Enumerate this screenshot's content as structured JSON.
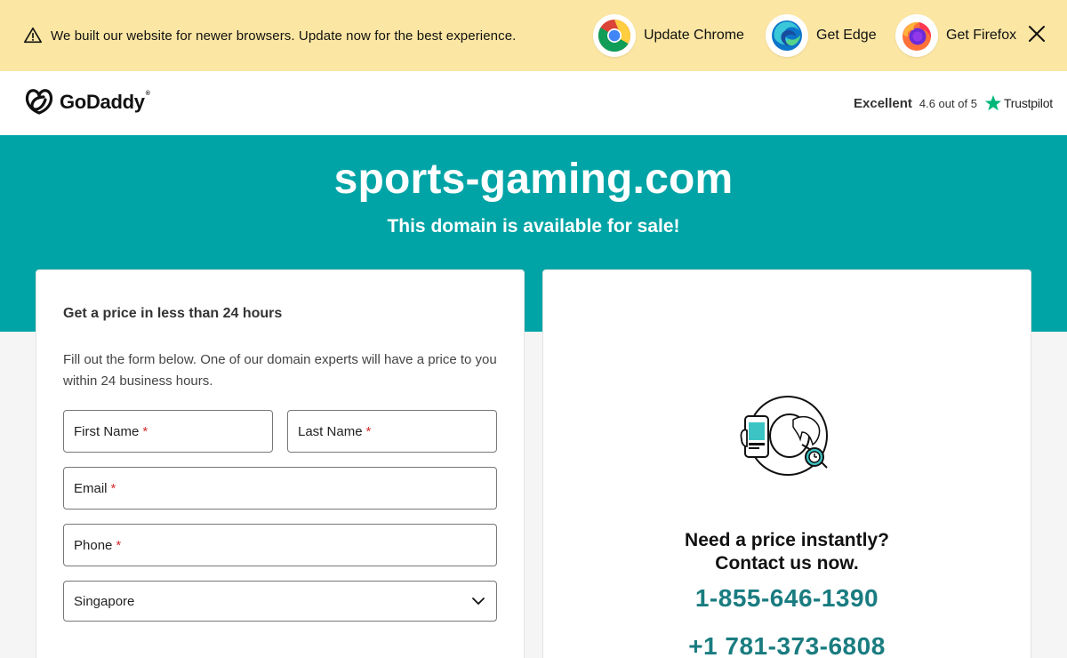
{
  "banner": {
    "message": "We built our website for newer browsers. Update now for the best experience.",
    "buttons": [
      {
        "label": "Update Chrome",
        "icon": "chrome-icon"
      },
      {
        "label": "Get Edge",
        "icon": "edge-icon"
      },
      {
        "label": "Get Firefox",
        "icon": "firefox-icon"
      }
    ],
    "close_icon": "close-icon"
  },
  "header": {
    "logo_text": "GoDaddy",
    "trust": {
      "label": "Excellent",
      "rating": "4.6 out of 5",
      "brand": "Trustpilot"
    }
  },
  "hero": {
    "domain": "sports-gaming.com",
    "subtitle": "This domain is available for sale!"
  },
  "form": {
    "heading": "Get a price in less than 24 hours",
    "description": "Fill out the form below. One of our domain experts will have a price to you within 24 business hours.",
    "first_name": "First Name",
    "last_name": "Last Name",
    "email": "Email",
    "phone": "Phone",
    "required_mark": "*",
    "country": "Singapore"
  },
  "contact": {
    "question_line1": "Need a price instantly?",
    "question_line2": "Contact us now.",
    "phone1": "1-855-646-1390",
    "phone2": "+1 781-373-6808"
  },
  "colors": {
    "banner_bg": "#fbe6a3",
    "hero_bg": "#00a4a6",
    "phone_color": "#1a7c80",
    "trustpilot_star": "#00b67a",
    "required": "#d32f2f"
  }
}
